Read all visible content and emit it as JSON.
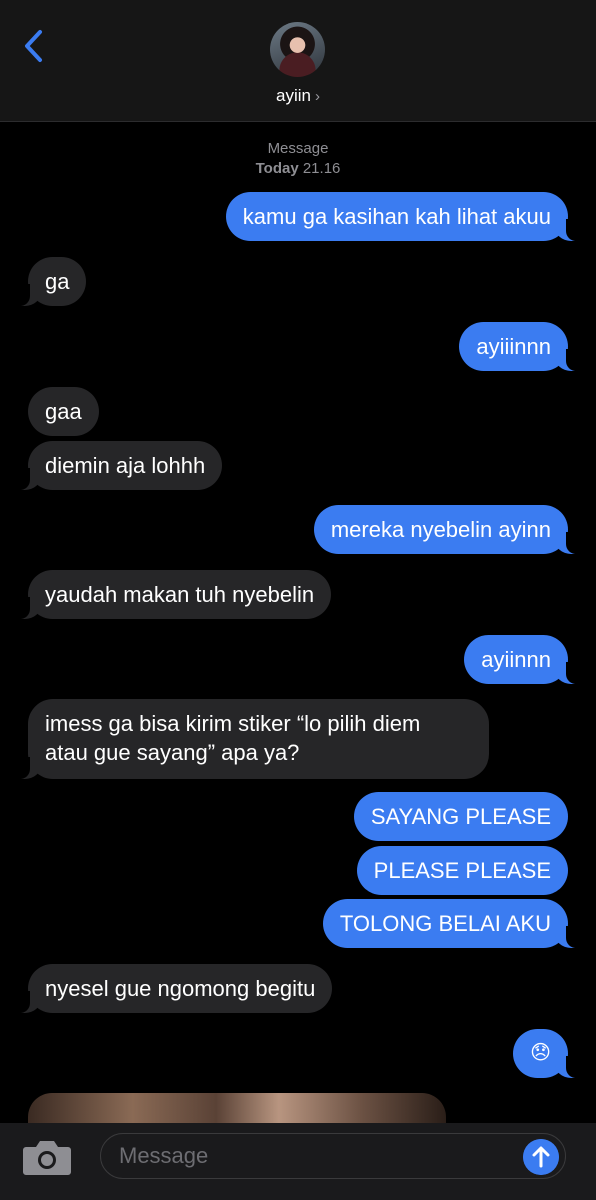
{
  "header": {
    "contact_name": "ayiin",
    "chevron": "›"
  },
  "meta": {
    "service": "Message",
    "day": "Today",
    "time": "21.16"
  },
  "messages": [
    {
      "from": "me",
      "text": "kamu ga kasihan kah lihat akuu"
    },
    {
      "from": "them",
      "text": "ga"
    },
    {
      "from": "me",
      "text": "ayiiinnn"
    },
    {
      "from": "them",
      "text": "gaa"
    },
    {
      "from": "them",
      "text": "diemin aja lohhh"
    },
    {
      "from": "me",
      "text": "mereka nyebelin ayinn"
    },
    {
      "from": "them",
      "text": "yaudah makan tuh nyebelin"
    },
    {
      "from": "me",
      "text": "ayiinnn"
    },
    {
      "from": "them",
      "text": "imess ga bisa kirim stiker “lo pilih diem",
      "text2": "atau gue sayang” apa ya?"
    },
    {
      "from": "me",
      "text": "SAYANG PLEASE"
    },
    {
      "from": "me",
      "text": "PLEASE PLEASE"
    },
    {
      "from": "me",
      "text": "TOLONG BELAI AKU"
    },
    {
      "from": "them",
      "text": "nyesel gue ngomong begitu"
    },
    {
      "from": "me",
      "text": "😞"
    }
  ],
  "composer": {
    "placeholder": "Message"
  },
  "colors": {
    "sent_bubble": "#3b7cf1",
    "received_bubble": "#262628",
    "background": "#000000",
    "accent": "#3b7cf1"
  },
  "icons": [
    "back-chevron-icon",
    "camera-icon",
    "send-arrow-icon"
  ]
}
